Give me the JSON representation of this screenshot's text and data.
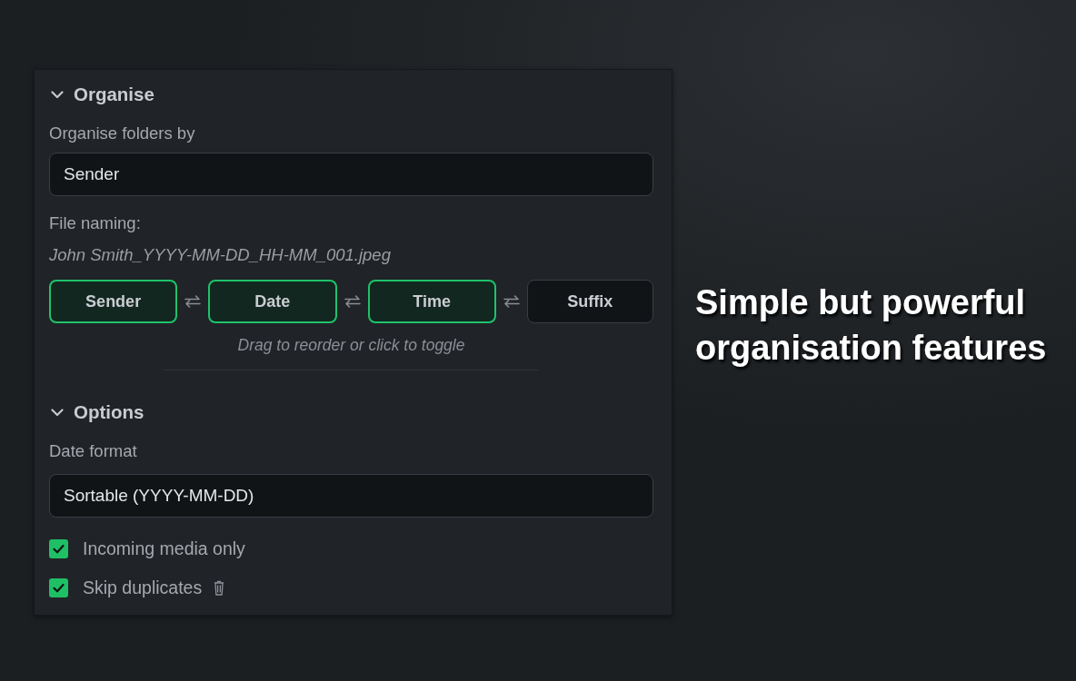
{
  "organise": {
    "title": "Organise",
    "expanded": true,
    "folder_label": "Organise folders by",
    "folder_value": "Sender",
    "naming_label": "File naming:",
    "naming_preview": "John Smith_YYYY-MM-DD_HH-MM_001.jpeg",
    "tokens": [
      {
        "label": "Sender",
        "on": true
      },
      {
        "label": "Date",
        "on": true
      },
      {
        "label": "Time",
        "on": true
      },
      {
        "label": "Suffix",
        "on": false
      }
    ],
    "hint": "Drag to reorder or click to toggle"
  },
  "options": {
    "title": "Options",
    "expanded": true,
    "date_label": "Date format",
    "date_value": "Sortable (YYYY-MM-DD)",
    "checkboxes": [
      {
        "label": "Incoming media only",
        "checked": true,
        "has_icon": false
      },
      {
        "label": "Skip duplicates",
        "checked": true,
        "has_icon": true
      }
    ]
  },
  "headline": "Simple but powerful organisation features"
}
